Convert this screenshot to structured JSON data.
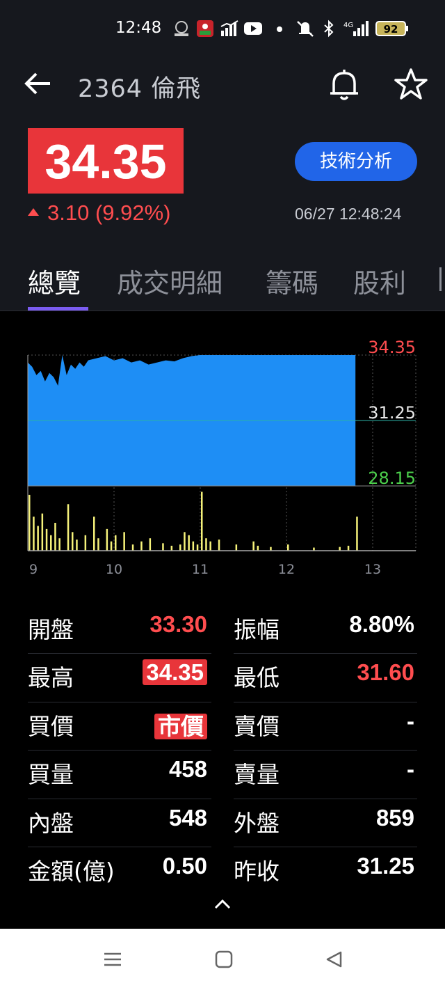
{
  "status_bar": {
    "time": "12:48",
    "battery": "92",
    "network": "4G",
    "icons": [
      "gomaji-icon",
      "app-red-icon",
      "signal-chart-icon",
      "youtube-icon",
      "dot-icon",
      "mute-icon",
      "bluetooth-icon",
      "cell-signal-icon",
      "battery-icon"
    ]
  },
  "header": {
    "title": "2364 倫飛",
    "back_icon": "arrow-left-icon",
    "bell_icon": "bell-icon",
    "star_icon": "star-icon"
  },
  "quote": {
    "price": "34.35",
    "change": "3.10 (9.92%)",
    "tech_button": "技術分析",
    "timestamp": "06/27 12:48:24"
  },
  "tabs": [
    {
      "label": "總覽",
      "active": true
    },
    {
      "label": "成交明細",
      "active": false
    },
    {
      "label": "籌碼",
      "active": false
    },
    {
      "label": "股利",
      "active": false
    }
  ],
  "chart_data": {
    "type": "area",
    "y_labels": {
      "high": "34.35",
      "mid": "31.25",
      "low": "28.15"
    },
    "ylim": [
      28.15,
      34.35
    ],
    "reference_price": 31.25,
    "x_ticks": [
      "9",
      "10",
      "11",
      "12",
      "13"
    ],
    "price_series": {
      "x": [
        9.0,
        9.05,
        9.1,
        9.15,
        9.2,
        9.25,
        9.3,
        9.35,
        9.4,
        9.45,
        9.5,
        9.55,
        9.6,
        9.65,
        9.7,
        9.8,
        9.9,
        10.0,
        10.1,
        10.2,
        10.3,
        10.4,
        10.5,
        10.6,
        10.7,
        10.8,
        10.9,
        11.0,
        11.5,
        12.0,
        12.5,
        12.8
      ],
      "y": [
        34.0,
        33.8,
        33.4,
        33.6,
        33.1,
        33.5,
        33.3,
        32.9,
        34.35,
        33.4,
        33.9,
        33.7,
        34.0,
        33.8,
        34.1,
        34.2,
        34.3,
        34.1,
        34.2,
        34.0,
        34.1,
        33.9,
        34.0,
        34.1,
        34.05,
        34.2,
        34.3,
        34.35,
        34.35,
        34.35,
        34.35,
        34.35
      ]
    },
    "volume_series": {
      "x": [
        9.0,
        9.05,
        9.1,
        9.15,
        9.2,
        9.25,
        9.3,
        9.35,
        9.45,
        9.5,
        9.55,
        9.65,
        9.75,
        9.8,
        9.9,
        9.95,
        10.0,
        10.1,
        10.2,
        10.3,
        10.4,
        10.55,
        10.65,
        10.75,
        10.8,
        10.85,
        10.9,
        10.95,
        11.0,
        11.05,
        11.1,
        11.2,
        11.4,
        11.6,
        11.65,
        11.8,
        12.0,
        12.3,
        12.6,
        12.7,
        12.8
      ],
      "y": [
        90,
        55,
        40,
        60,
        35,
        25,
        45,
        20,
        75,
        30,
        18,
        25,
        55,
        20,
        35,
        15,
        25,
        30,
        10,
        15,
        20,
        12,
        8,
        10,
        30,
        25,
        15,
        10,
        95,
        20,
        15,
        18,
        10,
        15,
        8,
        6,
        10,
        5,
        6,
        8,
        55
      ]
    }
  },
  "stats": {
    "left": [
      {
        "label": "開盤",
        "value": "33.30",
        "color": "red",
        "badge": false
      },
      {
        "label": "最高",
        "value": "34.35",
        "color": "white",
        "badge": true
      },
      {
        "label": "買價",
        "value": "市價",
        "color": "white",
        "badge": true
      },
      {
        "label": "買量",
        "value": "458",
        "color": "white",
        "badge": false
      },
      {
        "label": "內盤",
        "value": "548",
        "color": "white",
        "badge": false
      },
      {
        "label": "金額(億)",
        "value": "0.50",
        "color": "white",
        "badge": false
      }
    ],
    "right": [
      {
        "label": "振幅",
        "value": "8.80%",
        "color": "white",
        "badge": false
      },
      {
        "label": "最低",
        "value": "31.60",
        "color": "red",
        "badge": false
      },
      {
        "label": "賣價",
        "value": "-",
        "color": "white",
        "badge": false
      },
      {
        "label": "賣量",
        "value": "-",
        "color": "white",
        "badge": false
      },
      {
        "label": "外盤",
        "value": "859",
        "color": "white",
        "badge": false
      },
      {
        "label": "昨收",
        "value": "31.25",
        "color": "white",
        "badge": false
      }
    ]
  },
  "colors": {
    "up_red": "#ff4d4f",
    "area_blue": "#1e8ef5",
    "volume_yellow": "#f6f27a",
    "low_green": "#4ccf4c",
    "accent_purple": "#7b5cf0",
    "button_blue": "#2165e8"
  },
  "nav": {
    "menu_icon": "menu-lines-icon",
    "home_icon": "square-home-icon",
    "back_icon": "triangle-back-icon"
  }
}
